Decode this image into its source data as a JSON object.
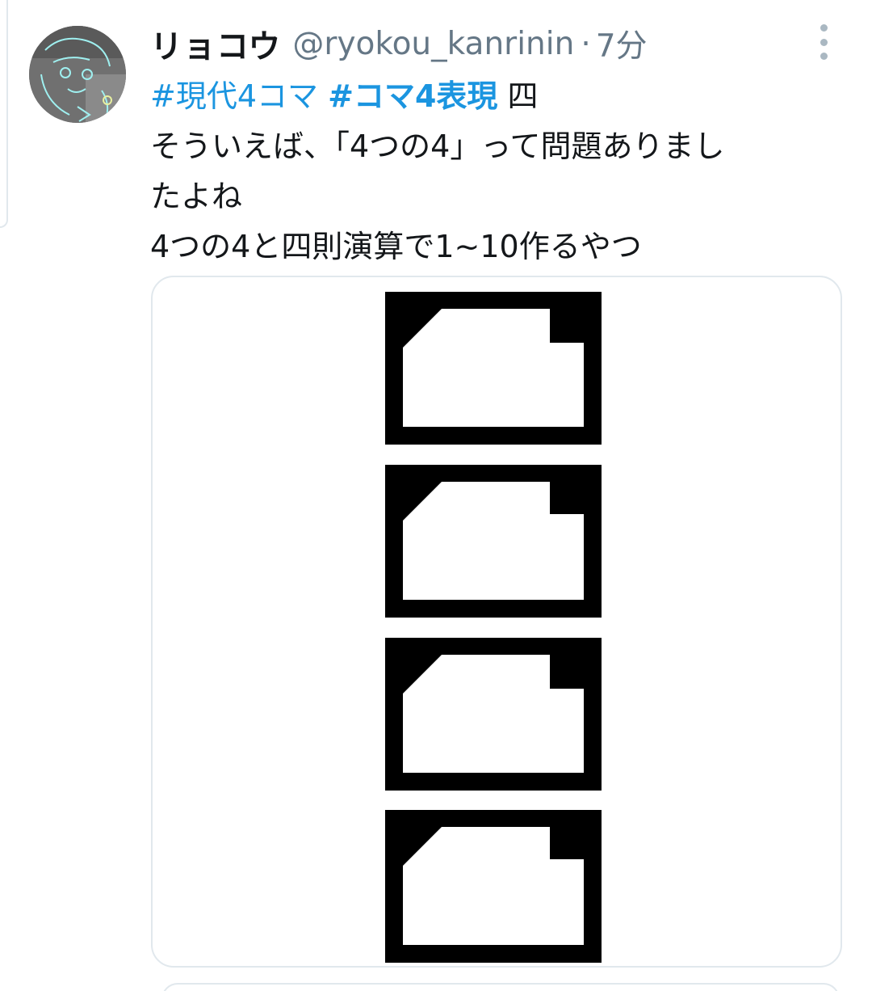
{
  "tweet": {
    "display_name": "リョコウ",
    "handle": "@ryokou_kanrinin",
    "separator": "·",
    "timestamp": "7分",
    "hashtags": [
      "#現代4コマ",
      "#コマ4表現"
    ],
    "trailing_glyph": "四",
    "text_lines": [
      "そういえば、「4つの4」って問題ありまし",
      "たよね",
      "4つの4と四則演算で1~10作るやつ"
    ]
  },
  "media": {
    "panel_count": 4,
    "colors": {
      "panel_fill": "#000000",
      "window_fill": "#ffffff"
    }
  },
  "icons": {
    "more": "more-vertical-icon",
    "avatar": "avatar-image"
  },
  "colors": {
    "link": "#1b95e0",
    "text": "#14171a",
    "muted": "#657786",
    "border": "#e1e8ed"
  }
}
